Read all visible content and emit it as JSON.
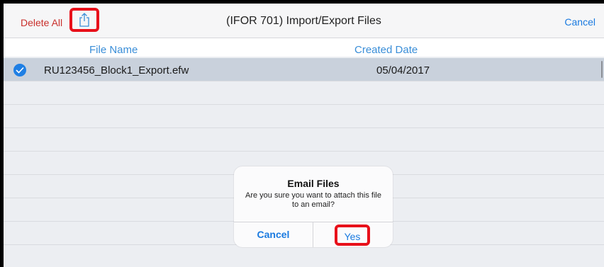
{
  "header": {
    "delete_all": "Delete All",
    "title": "(IFOR 701) Import/Export Files",
    "cancel": "Cancel",
    "share_icon": "share-icon"
  },
  "columns": {
    "file_name": "File Name",
    "created_date": "Created Date"
  },
  "files": [
    {
      "name": "RU123456_Block1_Export.efw",
      "date": "05/04/2017",
      "selected": true
    }
  ],
  "dialog": {
    "title": "Email Files",
    "message": "Are you sure you want to attach this file to an email?",
    "cancel": "Cancel",
    "yes": "Yes"
  },
  "colors": {
    "accent": "#1a7ae0",
    "destructive": "#c9302c",
    "highlight": "#e8101a",
    "selected_row": "#c9d1dc"
  }
}
